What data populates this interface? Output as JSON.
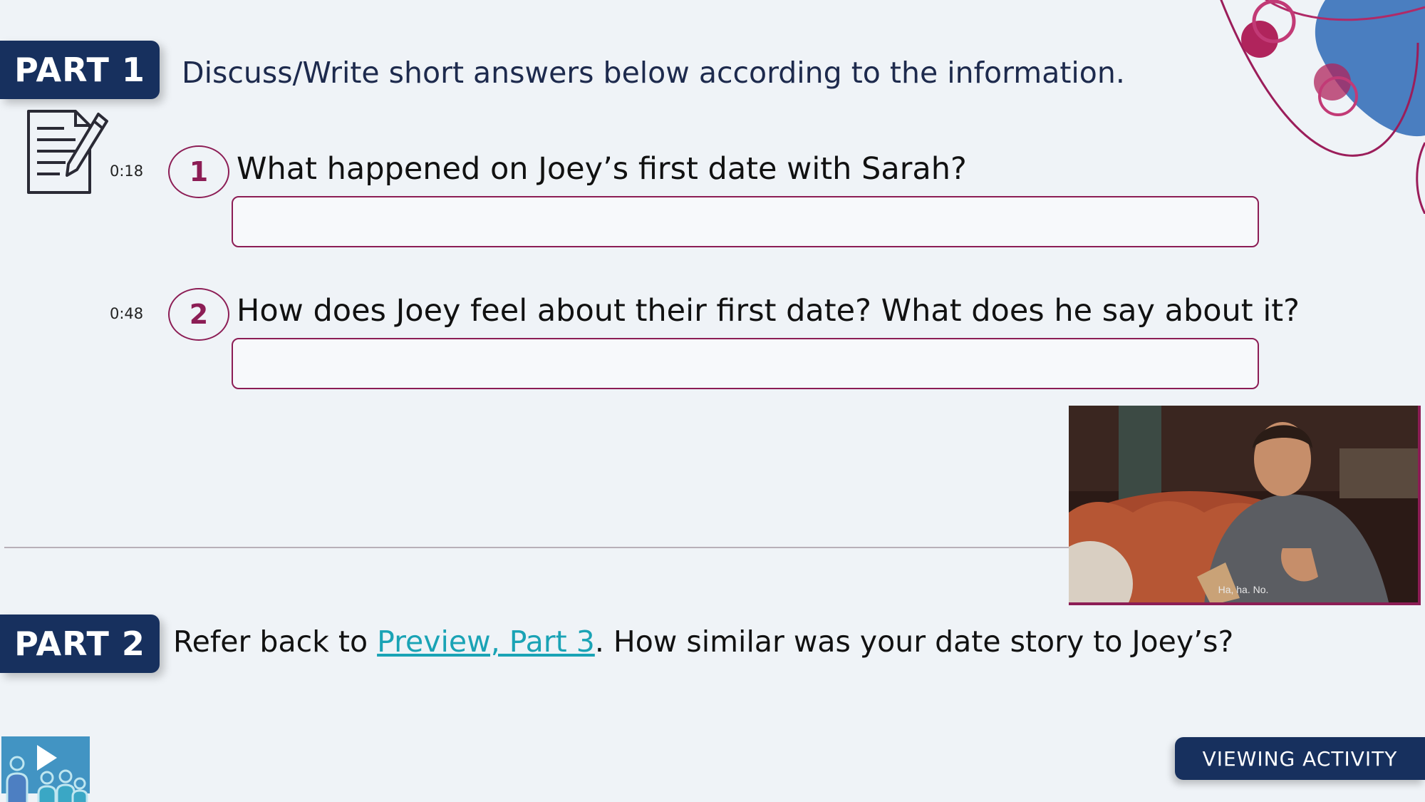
{
  "part1": {
    "badge": "PART 1",
    "instruction": "Discuss/Write short answers below according to the information."
  },
  "questions": [
    {
      "timestamp": "0:18",
      "number": "1",
      "text": "What happened on Joey’s first date with Sarah?",
      "answer": ""
    },
    {
      "timestamp": "0:48",
      "number": "2",
      "text": "How does Joey feel about their first date? What does he say about it?",
      "answer": ""
    }
  ],
  "video": {
    "subtitle": "Ha, ha. No."
  },
  "part2": {
    "badge": "PART 2",
    "prefix": "Refer back to ",
    "link": "Preview, Part 3",
    "suffix": ". How similar was your date story to Joey’s?"
  },
  "footer": {
    "activity_label": "VIEWING ACTIVITY"
  },
  "colors": {
    "navy": "#17305e",
    "accent": "#8c1d55",
    "link": "#1aa3b5",
    "background": "#eff3f7"
  }
}
